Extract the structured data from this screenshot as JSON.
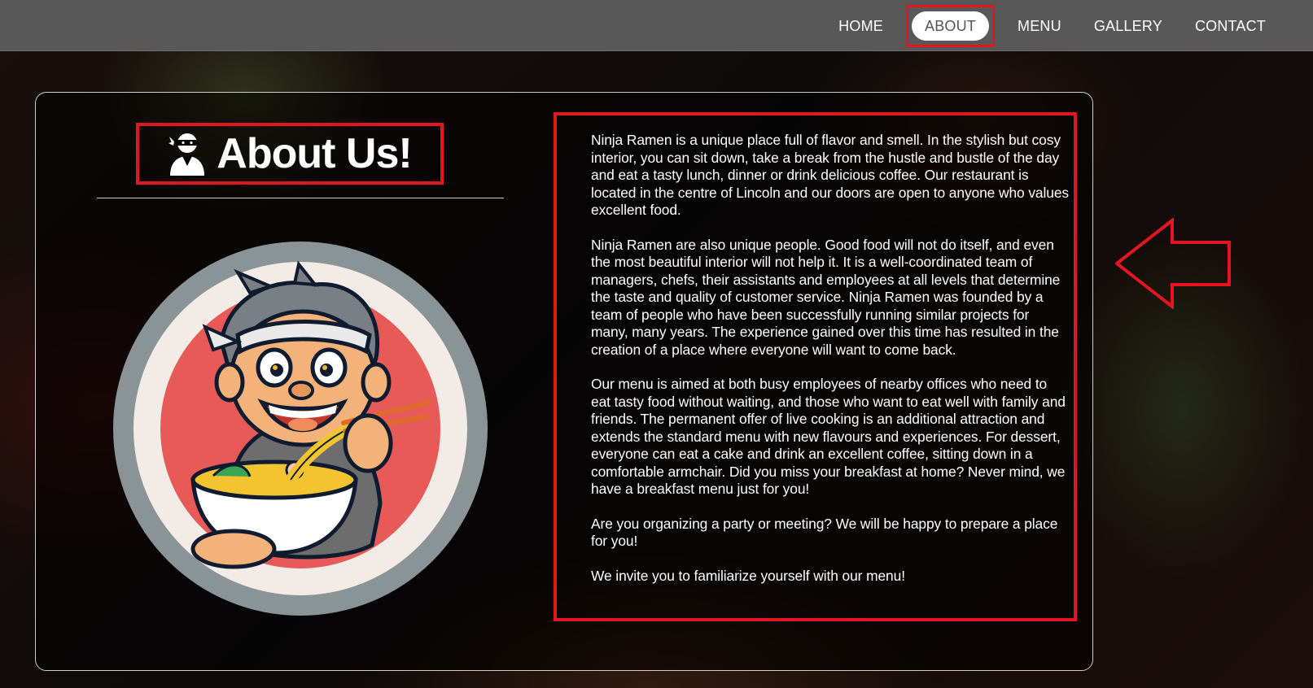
{
  "nav": {
    "items": [
      {
        "label": "HOME"
      },
      {
        "label": "ABOUT",
        "active": true
      },
      {
        "label": "MENU"
      },
      {
        "label": "GALLERY"
      },
      {
        "label": "CONTACT"
      }
    ]
  },
  "about": {
    "title": "About Us!",
    "paragraphs": [
      "Ninja Ramen is a unique place full of flavor and smell. In the stylish but cosy interior, you can sit down, take a break from the hustle and bustle of the day and eat a tasty lunch, dinner or drink delicious coffee. Our restaurant is located in the centre of Lincoln and our doors are open to anyone who values excellent food.",
      "Ninja Ramen are also unique people. Good food will not do itself, and even the most beautiful interior will not help it. It is a well-coordinated team of managers, chefs, their assistants and employees at all levels that determine the taste and quality of customer service. Ninja Ramen was founded by a team of people who have been successfully running similar projects for many, many years. The experience gained over this time has resulted in the creation of a place where everyone will want to come back.",
      "Our menu is aimed at both busy employees of nearby offices who need to eat tasty food without waiting, and those who want to eat well with family and friends. The permanent offer of live cooking is an additional attraction and extends the standard menu with new flavours and experiences. For dessert, everyone can eat a cake and drink an excellent coffee, sitting down in a comfortable armchair. Did you miss your breakfast at home? Never mind, we have a breakfast menu just for you!",
      "Are you organizing a party or meeting? We will be happy to prepare a place for you!",
      "We invite you to familiarize yourself with our menu!"
    ]
  },
  "icons": {
    "heading": "user-ninja-icon",
    "logo": "ninja-ramen-mascot-logo",
    "annotation": "left-arrow-annotation"
  },
  "colors": {
    "highlight": "#e3161f",
    "navbar": "#585858",
    "logo_ring": "#8a9396",
    "logo_inner": "#f3ebe6",
    "logo_center": "#e85a57"
  }
}
